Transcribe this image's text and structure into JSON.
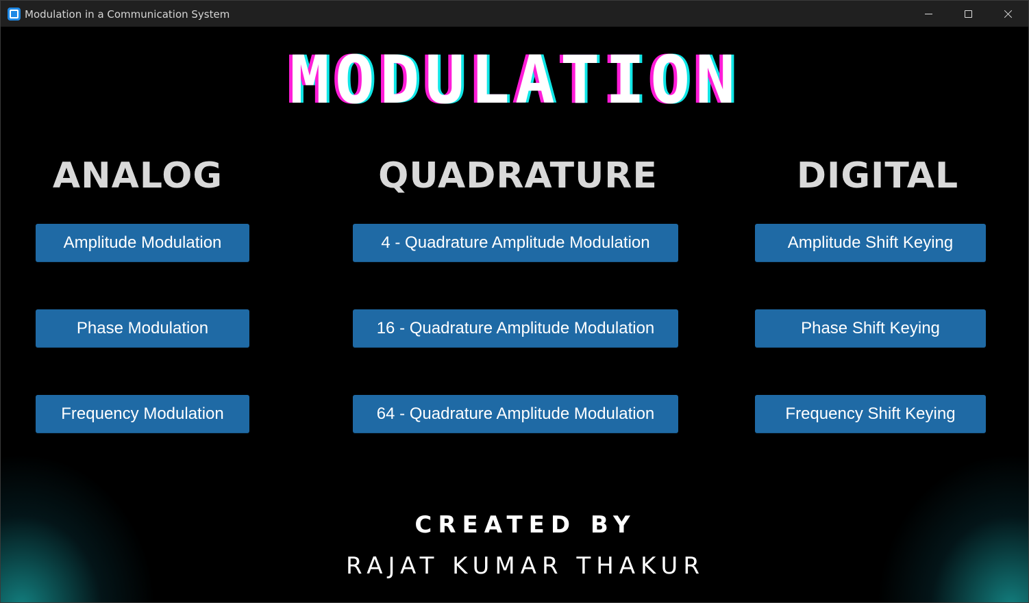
{
  "window": {
    "title": "Modulation in a Communication System",
    "icon": "app-icon"
  },
  "main": {
    "title": "MODULATION",
    "title_colors": {
      "fill": "#ffffff",
      "shadow_left": "#ff1dd8",
      "shadow_right": "#10e6e6"
    }
  },
  "sections": {
    "analog": {
      "heading": "ANALOG",
      "buttons": [
        "Amplitude Modulation",
        "Phase Modulation",
        "Frequency Modulation"
      ]
    },
    "quadrature": {
      "heading": "QUADRATURE",
      "buttons": [
        "4 - Quadrature Amplitude Modulation",
        "16 - Quadrature Amplitude Modulation",
        "64 - Quadrature Amplitude Modulation"
      ]
    },
    "digital": {
      "heading": "DIGITAL",
      "buttons": [
        "Amplitude Shift Keying",
        "Phase Shift Keying",
        "Frequency Shift Keying"
      ]
    }
  },
  "credits": {
    "heading": "CREATED BY",
    "name": "RAJAT KUMAR THAKUR"
  },
  "colors": {
    "button_bg": "#1f6aa5",
    "background": "#000000",
    "glow": "#169696"
  }
}
